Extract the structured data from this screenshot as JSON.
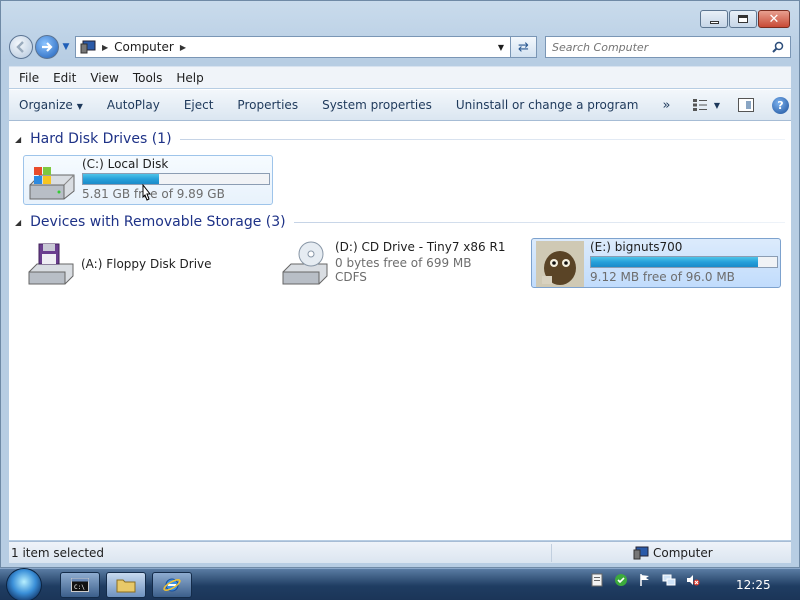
{
  "address": {
    "path": "Computer",
    "search_placeholder": "Search Computer"
  },
  "menu": [
    "File",
    "Edit",
    "View",
    "Tools",
    "Help"
  ],
  "commands": {
    "organize": "Organize",
    "autoplay": "AutoPlay",
    "eject": "Eject",
    "properties": "Properties",
    "system_properties": "System properties",
    "uninstall": "Uninstall or change a program",
    "more": "»"
  },
  "groups": {
    "hard_disks": "Hard Disk Drives (1)",
    "removable": "Devices with Removable Storage (3)"
  },
  "drives": {
    "c": {
      "name": "(C:) Local Disk",
      "free": "5.81 GB free of 9.89 GB",
      "used_fraction": 0.41
    },
    "a": {
      "name": "(A:) Floppy Disk Drive"
    },
    "d": {
      "name": "(D:) CD Drive - Tiny7 x86 R1",
      "free": "0 bytes free of 699 MB",
      "fs": "CDFS"
    },
    "e": {
      "name": "(E:) bignuts700",
      "free": "9.12 MB free of 96.0 MB",
      "used_fraction": 0.9
    }
  },
  "status": {
    "selection": "1 item selected",
    "location": "Computer"
  },
  "clock": "12:25",
  "colors": {
    "accent": "#26a0da",
    "group_header": "#1e3287",
    "selection": "#c1dcfc"
  }
}
